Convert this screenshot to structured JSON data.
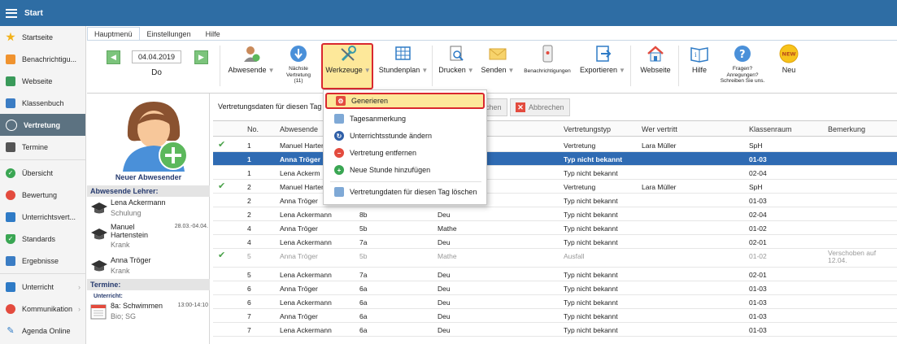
{
  "app": {
    "title": "Start"
  },
  "sidebar": {
    "items": [
      {
        "label": "Startseite",
        "color": "#f2b21b"
      },
      {
        "label": "Benachrichtigu...",
        "color": "#f0932f"
      },
      {
        "label": "Webseite",
        "color": "#3a9a5a"
      },
      {
        "label": "Klassenbuch",
        "color": "#3b7dc4"
      },
      {
        "label": "Vertretung",
        "color": "#ffffff"
      },
      {
        "label": "Termine",
        "color": "#555555"
      },
      {
        "label": "Übersicht",
        "color": "#3aa653"
      },
      {
        "label": "Bewertung",
        "color": "#e34b3e"
      },
      {
        "label": "Unterrichtsvert...",
        "color": "#2f7bc6"
      },
      {
        "label": "Standards",
        "color": "#3aa653"
      },
      {
        "label": "Ergebnisse",
        "color": "#3b7dc4"
      },
      {
        "label": "Unterricht",
        "color": "#2f7bc6"
      },
      {
        "label": "Kommunikation",
        "color": "#e34b3e"
      },
      {
        "label": "Agenda Online",
        "color": "#2f7bc6"
      }
    ]
  },
  "tabs": [
    "Hauptmenü",
    "Einstellungen",
    "Hilfe"
  ],
  "ribbon": {
    "date": "04.04.2019",
    "day": "Do",
    "abwesende": "Abwesende",
    "naechste": "Nächste Vertretung (11)",
    "werkzeuge": "Werkzeuge",
    "stundenplan": "Stundenplan",
    "drucken": "Drucken",
    "senden": "Senden",
    "benachrichtigungen": "Benachrichtigungen",
    "exportieren": "Exportieren",
    "webseite": "Webseite",
    "hilfe": "Hilfe",
    "fragen": "Fragen? Anregungen? Schreiben Sie uns.",
    "neu": "Neu",
    "neu_badge": "NEW"
  },
  "left": {
    "new_absent": "Neuer Abwesender",
    "absent_heading": "Abwesende Lehrer:",
    "teachers": [
      {
        "name": "Lena Ackermann",
        "sub": "Schulung",
        "date": ""
      },
      {
        "name": "Manuel Hartenstein",
        "sub": "Krank",
        "date": "28.03.-04.04."
      },
      {
        "name": "Anna Tröger",
        "sub": "Krank",
        "date": ""
      }
    ],
    "termine_heading": "Termine:",
    "unterricht_label": "Unterricht:",
    "termin": {
      "title": "8a: Schwimmen",
      "sub": "Bio; SG",
      "time": "13:00-14:10"
    }
  },
  "toolbar": {
    "label": "Vertretungsdaten für diesen Tag",
    "partial_btn": "chen",
    "cancel": "Abbrechen"
  },
  "menu": {
    "items": [
      "Generieren",
      "Tagesanmerkung",
      "Unterrichtsstunde ändern",
      "Vertretung entfernen",
      "Neue Stunde hinzufügen",
      "Vertretungdaten für diesen Tag löschen"
    ]
  },
  "table": {
    "headers": [
      "No.",
      "Abwesende",
      "Vertretungstyp",
      "Wer vertritt",
      "Klassenraum",
      "Bemerkung"
    ],
    "rows": [
      {
        "check": "✔",
        "no": "1",
        "abw": "Manuel Harten",
        "klasse": "",
        "fach": "",
        "typ": "Vertretung",
        "wer": "Lara Müller",
        "raum": "SpH",
        "bem": ""
      },
      {
        "check": "",
        "no": "1",
        "abw": "Anna Tröger",
        "klasse": "",
        "fach": "",
        "typ": "Typ nicht bekannt",
        "wer": "",
        "raum": "01-03",
        "bem": ""
      },
      {
        "check": "",
        "no": "1",
        "abw": "Lena Ackerm",
        "klasse": "",
        "fach": "",
        "typ": "Typ nicht bekannt",
        "wer": "",
        "raum": "02-04",
        "bem": ""
      },
      {
        "check": "✔",
        "no": "2",
        "abw": "Manuel Harten",
        "klasse": "",
        "fach": "",
        "typ": "Vertretung",
        "wer": "Lara Müller",
        "raum": "SpH",
        "bem": ""
      },
      {
        "check": "",
        "no": "2",
        "abw": "Anna Tröger",
        "klasse": "",
        "fach": "",
        "typ": "Typ nicht bekannt",
        "wer": "",
        "raum": "01-03",
        "bem": ""
      },
      {
        "check": "",
        "no": "2",
        "abw": "Lena Ackermann",
        "klasse": "8b",
        "fach": "Deu",
        "typ": "Typ nicht bekannt",
        "wer": "",
        "raum": "02-04",
        "bem": ""
      },
      {
        "check": "",
        "no": "4",
        "abw": "Anna Tröger",
        "klasse": "5b",
        "fach": "Mathe",
        "typ": "Typ nicht bekannt",
        "wer": "",
        "raum": "01-02",
        "bem": ""
      },
      {
        "check": "",
        "no": "4",
        "abw": "Lena Ackermann",
        "klasse": "7a",
        "fach": "Deu",
        "typ": "Typ nicht bekannt",
        "wer": "",
        "raum": "02-01",
        "bem": ""
      },
      {
        "check": "✔",
        "no": "5",
        "abw": "Anna Tröger",
        "klasse": "5b",
        "fach": "Mathe",
        "typ": "Ausfall",
        "wer": "",
        "raum": "01-02",
        "bem": "Verschoben auf 12.04."
      },
      {
        "check": "",
        "no": "5",
        "abw": "Lena Ackermann",
        "klasse": "7a",
        "fach": "Deu",
        "typ": "Typ nicht bekannt",
        "wer": "",
        "raum": "02-01",
        "bem": ""
      },
      {
        "check": "",
        "no": "6",
        "abw": "Anna Tröger",
        "klasse": "6a",
        "fach": "Deu",
        "typ": "Typ nicht bekannt",
        "wer": "",
        "raum": "01-03",
        "bem": ""
      },
      {
        "check": "",
        "no": "6",
        "abw": "Lena Ackermann",
        "klasse": "6a",
        "fach": "Deu",
        "typ": "Typ nicht bekannt",
        "wer": "",
        "raum": "01-03",
        "bem": ""
      },
      {
        "check": "",
        "no": "7",
        "abw": "Anna Tröger",
        "klasse": "6a",
        "fach": "Deu",
        "typ": "Typ nicht bekannt",
        "wer": "",
        "raum": "01-03",
        "bem": ""
      },
      {
        "check": "",
        "no": "7",
        "abw": "Lena Ackermann",
        "klasse": "6a",
        "fach": "Deu",
        "typ": "Typ nicht bekannt",
        "wer": "",
        "raum": "01-03",
        "bem": ""
      }
    ]
  }
}
